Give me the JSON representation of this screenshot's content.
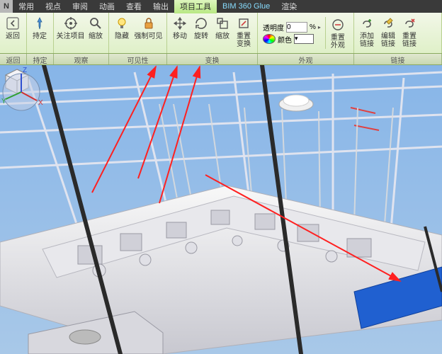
{
  "menubar": {
    "items": [
      "常用",
      "视点",
      "审阅",
      "动画",
      "查看",
      "输出",
      "项目工具",
      "BIM 360 Glue",
      "渲染"
    ],
    "active_index": 6
  },
  "ribbon": {
    "groups": [
      {
        "panel": "返回",
        "buttons": [
          {
            "id": "back",
            "label": "返回",
            "icon": "arrow-left"
          }
        ]
      },
      {
        "panel": "持定",
        "buttons": [
          {
            "id": "hold",
            "label": "持定",
            "icon": "pin"
          }
        ]
      },
      {
        "panel": "观察",
        "buttons": [
          {
            "id": "focus-item",
            "label": "关注项目",
            "icon": "target"
          },
          {
            "id": "zoom",
            "label": "缩放",
            "icon": "magnifier"
          }
        ]
      },
      {
        "panel": "可见性",
        "buttons": [
          {
            "id": "hide",
            "label": "隐藏",
            "icon": "bulb"
          },
          {
            "id": "force-visible",
            "label": "强制可见",
            "icon": "lock"
          }
        ]
      },
      {
        "panel": "变换",
        "buttons": [
          {
            "id": "move",
            "label": "移动",
            "icon": "move"
          },
          {
            "id": "rotate",
            "label": "旋转",
            "icon": "rotate"
          },
          {
            "id": "scale",
            "label": "缩放",
            "icon": "scale"
          },
          {
            "id": "reset-transform",
            "label": "重置\n变换",
            "icon": "reset"
          }
        ]
      },
      {
        "panel": "外观",
        "opacity": {
          "label": "透明度",
          "value": "0",
          "unit": "%"
        },
        "color": {
          "label": "颜色"
        },
        "buttons": [
          {
            "id": "reset-appearance",
            "label": "重置\n外观",
            "icon": "reset"
          }
        ]
      },
      {
        "panel": "链接",
        "buttons": [
          {
            "id": "add-link",
            "label": "添加\n链接",
            "icon": "link-add"
          },
          {
            "id": "edit-link",
            "label": "编辑\n链接",
            "icon": "link-edit"
          },
          {
            "id": "reset-link",
            "label": "重置\n链接",
            "icon": "link-reset"
          }
        ]
      }
    ]
  },
  "panels": [
    "返回",
    "持定",
    "观察",
    "可见性",
    "变换",
    "外观",
    "链接"
  ],
  "axes": {
    "x": "X",
    "y": "Y",
    "z": "Z"
  }
}
